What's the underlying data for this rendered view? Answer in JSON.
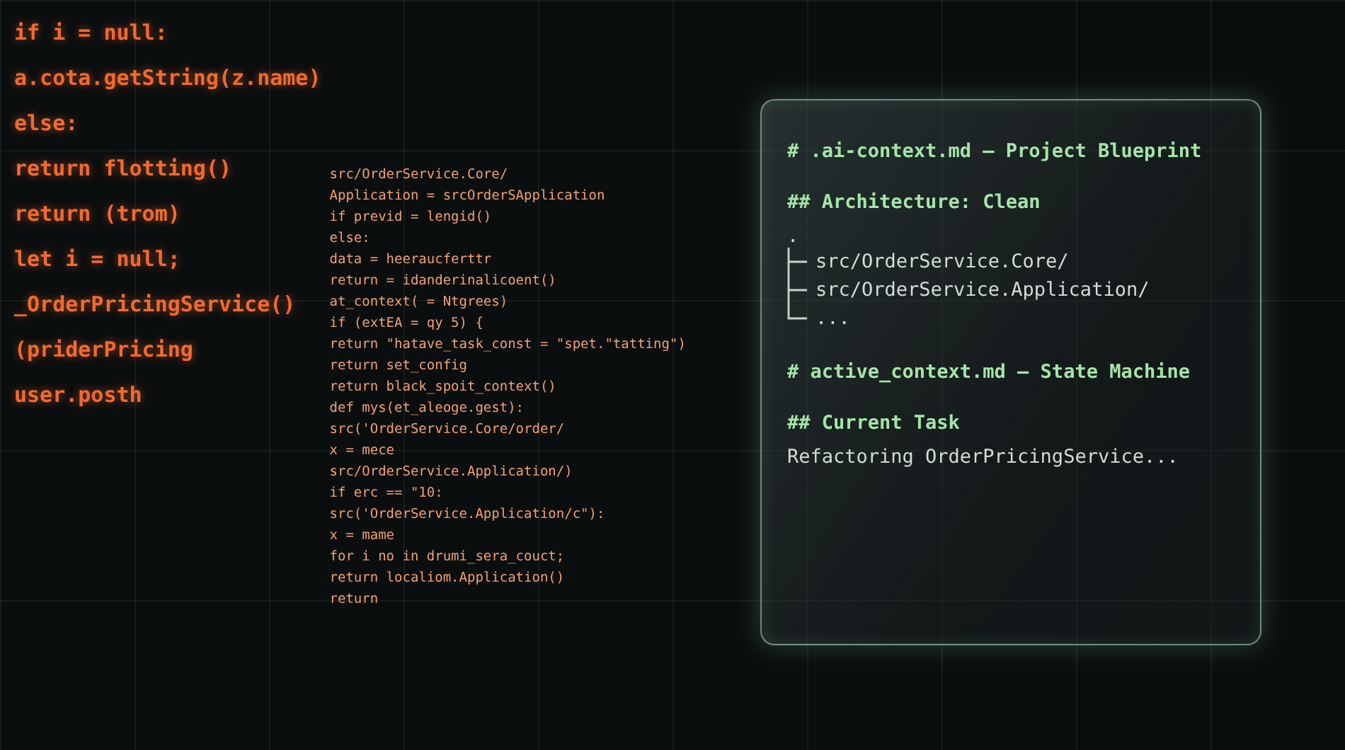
{
  "code_art": {
    "near_lines": [
      "if i = null:",
      "a.cota.getString(z.name)",
      "else:",
      "return flotting()",
      "return (trom)",
      "let i = null;",
      "_OrderPricingService()",
      "(priderPricing",
      "user.posth"
    ],
    "far_lines": [
      "src/OrderService.Core/",
      "Application = srcOrderSApplication",
      "if previd = lengid()",
      "else:",
      "data = heeraucferttr",
      "return = idanderinalicoent()",
      "at_context( = Ntgrees)",
      "if (extEA = qy 5) {",
      "return \"hatave_task_const = \"spet.\"tatting\")",
      "return set_config",
      "return black_spoit_context()",
      "def mys(et_aleoge.gest):",
      "src('OrderService.Core/order/",
      "x = mece",
      "src/OrderService.Application/)",
      "if erc == \"10:",
      "src('OrderService.Application/c\"):",
      "x = mame",
      "for i no in drumi_sera_couct;",
      "return localiom.Application()",
      "return"
    ]
  },
  "panel": {
    "items": [
      {
        "kind": "h1",
        "text": "# .ai-context.md — Project Blueprint"
      },
      {
        "kind": "h2",
        "text": "## Architecture: Clean"
      },
      {
        "kind": "tree",
        "text": ".",
        "children": [
          {
            "text": "src/OrderService.Core/"
          },
          {
            "text": "src/OrderService.Application/"
          },
          {
            "text": "..."
          }
        ]
      },
      {
        "kind": "h1",
        "text": "# active_context.md — State Machine"
      },
      {
        "kind": "h2",
        "text": "## Current Task"
      },
      {
        "kind": "text",
        "text": "Refactoring OrderPricingService..."
      }
    ]
  }
}
